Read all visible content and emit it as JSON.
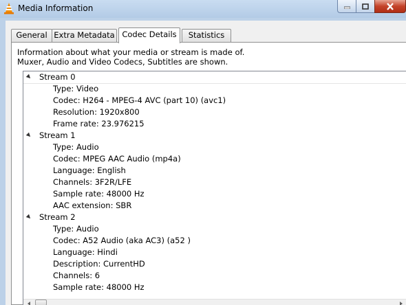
{
  "window": {
    "title": "Media Information",
    "icon": "vlc-cone-icon",
    "controls": [
      "minimize-icon",
      "maximize-icon",
      "close-icon"
    ]
  },
  "tabs": [
    {
      "label": "General",
      "active": false
    },
    {
      "label": "Extra Metadata",
      "active": false
    },
    {
      "label": "Codec Details",
      "active": true
    },
    {
      "label": "Statistics",
      "active": false
    }
  ],
  "info_text": {
    "line1": "Information about what your media or stream is made of.",
    "line2": "Muxer, Audio and Video Codecs, Subtitles are shown."
  },
  "streams": [
    {
      "label": "Stream 0",
      "details": [
        "Type: Video",
        "Codec: H264 - MPEG-4 AVC (part 10) (avc1)",
        "Resolution: 1920x800",
        "Frame rate: 23.976215"
      ]
    },
    {
      "label": "Stream 1",
      "details": [
        "Type: Audio",
        "Codec: MPEG AAC Audio (mp4a)",
        "Language: English",
        "Channels: 3F2R/LFE",
        "Sample rate: 48000 Hz",
        "AAC extension: SBR"
      ]
    },
    {
      "label": "Stream 2",
      "details": [
        "Type: Audio",
        "Codec: A52 Audio (aka AC3) (a52 )",
        "Language: Hindi",
        "Description: CurrentHD",
        "Channels: 6",
        "Sample rate: 48000 Hz"
      ]
    }
  ]
}
